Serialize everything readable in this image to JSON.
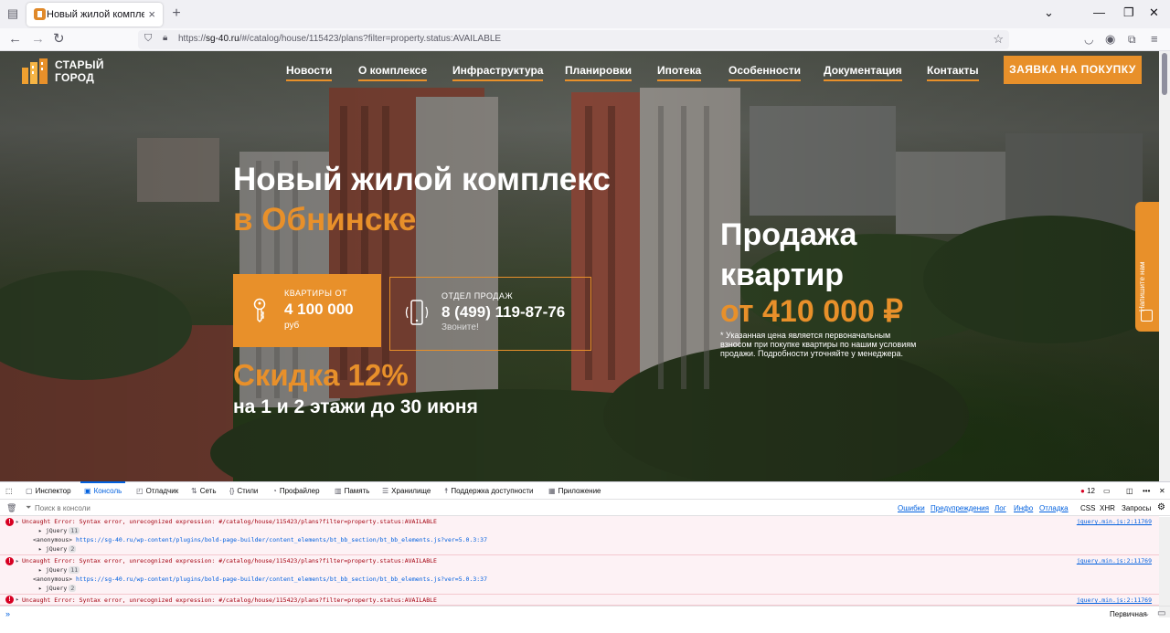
{
  "browser": {
    "tab_title": "Новый жилой комплекс в Обн",
    "url_prefix": "https://",
    "url_host": "sg-40.ru",
    "url_path": "/#/catalog/house/115423/plans?filter=property.status:AVAILABLE"
  },
  "site": {
    "logo_line1": "СТАРЫЙ",
    "logo_line2": "ГОРОД",
    "menu": [
      "Новости",
      "О комплексе",
      "Инфраструктура",
      "Планировки",
      "Ипотека",
      "Особенности",
      "Документация",
      "Контакты"
    ],
    "cta": "ЗАЯВКА НА ПОКУПКУ",
    "accent_color": "#e8902a"
  },
  "hero": {
    "title_line1": "Новый жилой комплекс",
    "title_line2": "в Обнинске",
    "price_label": "КВАРТИРЫ ОТ",
    "price_value": "4 100 000",
    "price_unit": "руб",
    "phone_label": "ОТДЕЛ ПРОДАЖ",
    "phone_value": "8 (499) 119-87-76",
    "phone_note": "Звоните!",
    "discount": "Скидка 12%",
    "discount_note": "на 1 и 2 этажи до 30 июня",
    "sale_line1": "Продажа",
    "sale_line2": "квартир",
    "sale_price": "от 410 000 ₽",
    "fine_print": "* Указанная цена является первоначальным взносом при покупке квартиры по нашим условиям продажи. Подробности уточняйте у менеджера.",
    "side_tab": "Напишите нам"
  },
  "devtools": {
    "tabs": [
      "Инспектор",
      "Консоль",
      "Отладчик",
      "Сеть",
      "Стили",
      "Профайлер",
      "Память",
      "Хранилище",
      "Поддержка доступности",
      "Приложение"
    ],
    "error_count": "12",
    "filter_placeholder": "Поиск в консоли",
    "filters": [
      "Ошибки",
      "Предупреждения",
      "Лог",
      "Инфо",
      "Отладка"
    ],
    "filters_plain": [
      "CSS",
      "XHR",
      "Запросы"
    ],
    "messages": [
      {
        "text": "Uncaught Error: Syntax error, unrecognized expression: #/catalog/house/115423/plans?filter=property.status:AVAILABLE",
        "loc": "jquery.min.js:2:11769",
        "frames": true
      },
      {
        "text": "Uncaught Error: Syntax error, unrecognized expression: #/catalog/house/115423/plans?filter=property.status:AVAILABLE",
        "loc": "jquery.min.js:2:11769",
        "frames": true
      },
      {
        "text": "Uncaught Error: Syntax error, unrecognized expression: #/catalog/house/115423/plans?filter=property.status:AVAILABLE",
        "loc": "jquery.min.js:2:11769",
        "frames": false
      }
    ],
    "frame_jquery": "jQuery",
    "frame_count1": "11",
    "frame_anon": "<anonymous>",
    "frame_url": "https://sg-40.ru/wp-content/plugins/bold-page-builder/content_elements/bt_bb_section/bt_bb_elements.js?ver=5.0.3:37",
    "frame_count2": "2",
    "input_mode": "Первичная"
  }
}
